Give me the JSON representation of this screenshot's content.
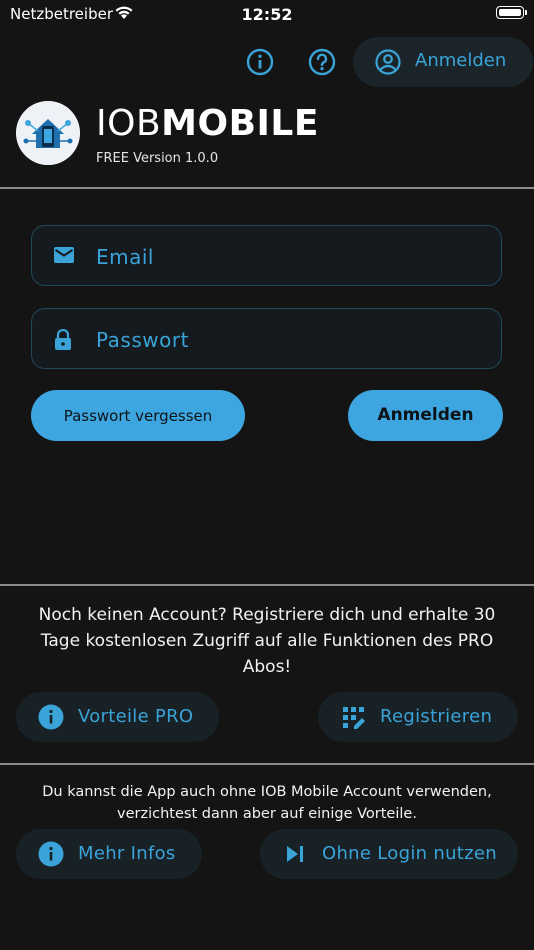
{
  "status_bar": {
    "carrier": "Netzbetreiber",
    "time": "12:52"
  },
  "header": {
    "info_icon": "info-icon",
    "help_icon": "help-icon",
    "login_label": "Anmelden"
  },
  "brand": {
    "name_light": "IOB",
    "name_bold": "MOBILE",
    "version": "FREE Version 1.0.0"
  },
  "form": {
    "email_placeholder": "Email",
    "password_placeholder": "Passwort",
    "forgot_label": "Passwort vergessen",
    "submit_label": "Anmelden"
  },
  "register": {
    "text": "Noch keinen Account? Registriere dich und erhalte 30 Tage kostenlosen Zugriff auf alle Funktionen des PRO Abos!",
    "pro_label": "Vorteile PRO",
    "register_label": "Registrieren"
  },
  "guest": {
    "text": "Du kannst die App auch ohne IOB Mobile Account verwenden, verzichtest dann aber auf einige Vorteile.",
    "more_label": "Mehr Infos",
    "skip_label": "Ohne Login nutzen"
  },
  "colors": {
    "accent": "#3da5df",
    "background": "#141414",
    "button_bg": "#182126"
  }
}
